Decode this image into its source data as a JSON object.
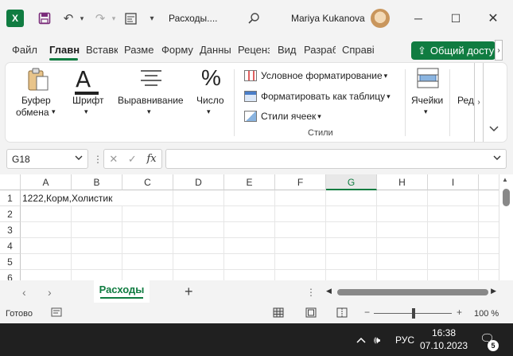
{
  "titlebar": {
    "doc_title": "Расходы....",
    "user_name": "Mariya Kukanova",
    "logo": "X"
  },
  "tabs": [
    "Файл",
    "Главн",
    "Вставк",
    "Разме",
    "Форму",
    "Данны",
    "Реценз",
    "Вид",
    "Разраб",
    "Справі"
  ],
  "share_button": "Общий досту",
  "ribbon": {
    "clipboard_1": "Буфер",
    "clipboard_2": "обмена",
    "font": "Шрифт",
    "alignment": "Выравнивание",
    "number": "Число",
    "conditional": "Условное форматирование",
    "format_table": "Форматировать как таблицу",
    "cell_styles": "Стили ячеек",
    "styles_caption": "Стили",
    "cells": "Ячейки",
    "editing": "Ред"
  },
  "formula_bar": {
    "name_box": "G18",
    "fx": "fx",
    "value": ""
  },
  "grid": {
    "columns": [
      "A",
      "B",
      "C",
      "D",
      "E",
      "F",
      "G",
      "H",
      "I"
    ],
    "selected_column": "G",
    "rows": [
      "1",
      "2",
      "3",
      "4",
      "5",
      "6"
    ],
    "a1": "1222,Корм,Холистик"
  },
  "sheet_tab": "Расходы",
  "status": {
    "ready": "Готово",
    "zoom": "100 %"
  },
  "taskbar": {
    "lang": "РУС",
    "time": "16:38",
    "date": "07.10.2023",
    "notifications": "5"
  },
  "colors": {
    "accent": "#107c41"
  }
}
